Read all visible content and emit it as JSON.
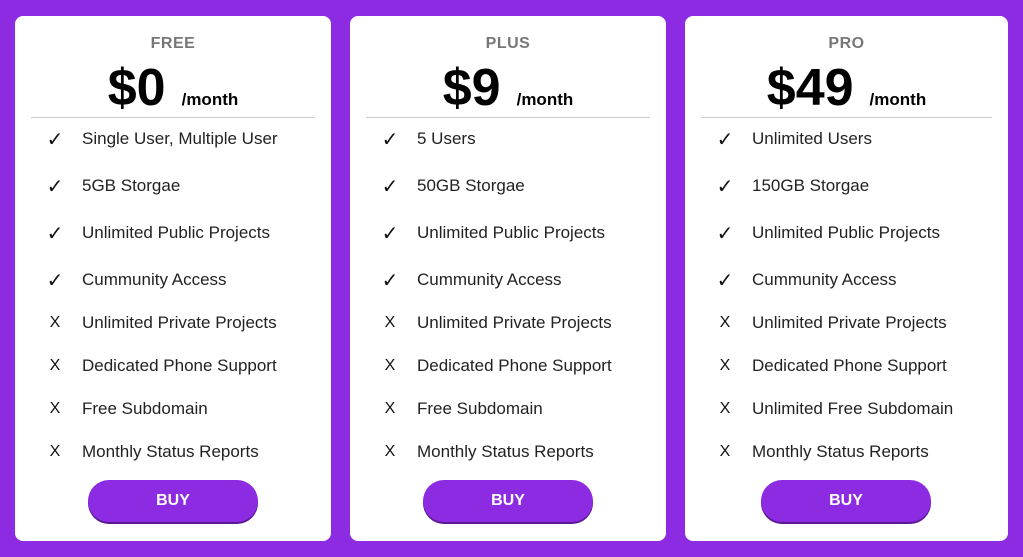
{
  "colors": {
    "background": "#8c2be2",
    "card": "#ffffff",
    "button": "#8c2be2",
    "button_text": "#ffffff"
  },
  "icons": {
    "included": "check-icon",
    "excluded": "cross-icon"
  },
  "plans": [
    {
      "name": "FREE",
      "price": "$0",
      "period": "/month",
      "button_label": "BUY",
      "features": [
        {
          "mark": "✓",
          "included": true,
          "text": "Single User, Multiple User"
        },
        {
          "mark": "✓",
          "included": true,
          "text": "5GB Storgae"
        },
        {
          "mark": "✓",
          "included": true,
          "text": "Unlimited Public Projects"
        },
        {
          "mark": "✓",
          "included": true,
          "text": "Cummunity Access"
        },
        {
          "mark": "X",
          "included": false,
          "text": "Unlimited Private Projects"
        },
        {
          "mark": "X",
          "included": false,
          "text": "Dedicated Phone Support"
        },
        {
          "mark": "X",
          "included": false,
          "text": "Free Subdomain"
        },
        {
          "mark": "X",
          "included": false,
          "text": "Monthly Status Reports"
        }
      ]
    },
    {
      "name": "PLUS",
      "price": "$9",
      "period": "/month",
      "button_label": "BUY",
      "features": [
        {
          "mark": "✓",
          "included": true,
          "text": "5 Users"
        },
        {
          "mark": "✓",
          "included": true,
          "text": "50GB Storgae"
        },
        {
          "mark": "✓",
          "included": true,
          "text": "Unlimited Public Projects"
        },
        {
          "mark": "✓",
          "included": true,
          "text": "Cummunity Access"
        },
        {
          "mark": "X",
          "included": false,
          "text": "Unlimited Private Projects"
        },
        {
          "mark": "X",
          "included": false,
          "text": "Dedicated Phone Support"
        },
        {
          "mark": "X",
          "included": false,
          "text": "Free Subdomain"
        },
        {
          "mark": "X",
          "included": false,
          "text": "Monthly Status Reports"
        }
      ]
    },
    {
      "name": "PRO",
      "price": "$49",
      "period": "/month",
      "button_label": "BUY",
      "features": [
        {
          "mark": "✓",
          "included": true,
          "text": "Unlimited Users"
        },
        {
          "mark": "✓",
          "included": true,
          "text": "150GB Storgae"
        },
        {
          "mark": "✓",
          "included": true,
          "text": "Unlimited Public Projects"
        },
        {
          "mark": "✓",
          "included": true,
          "text": "Cummunity Access"
        },
        {
          "mark": "X",
          "included": false,
          "text": "Unlimited Private Projects"
        },
        {
          "mark": "X",
          "included": false,
          "text": "Dedicated Phone Support"
        },
        {
          "mark": "X",
          "included": false,
          "text": "Unlimited Free Subdomain"
        },
        {
          "mark": "X",
          "included": false,
          "text": "Monthly Status Reports"
        }
      ]
    }
  ]
}
